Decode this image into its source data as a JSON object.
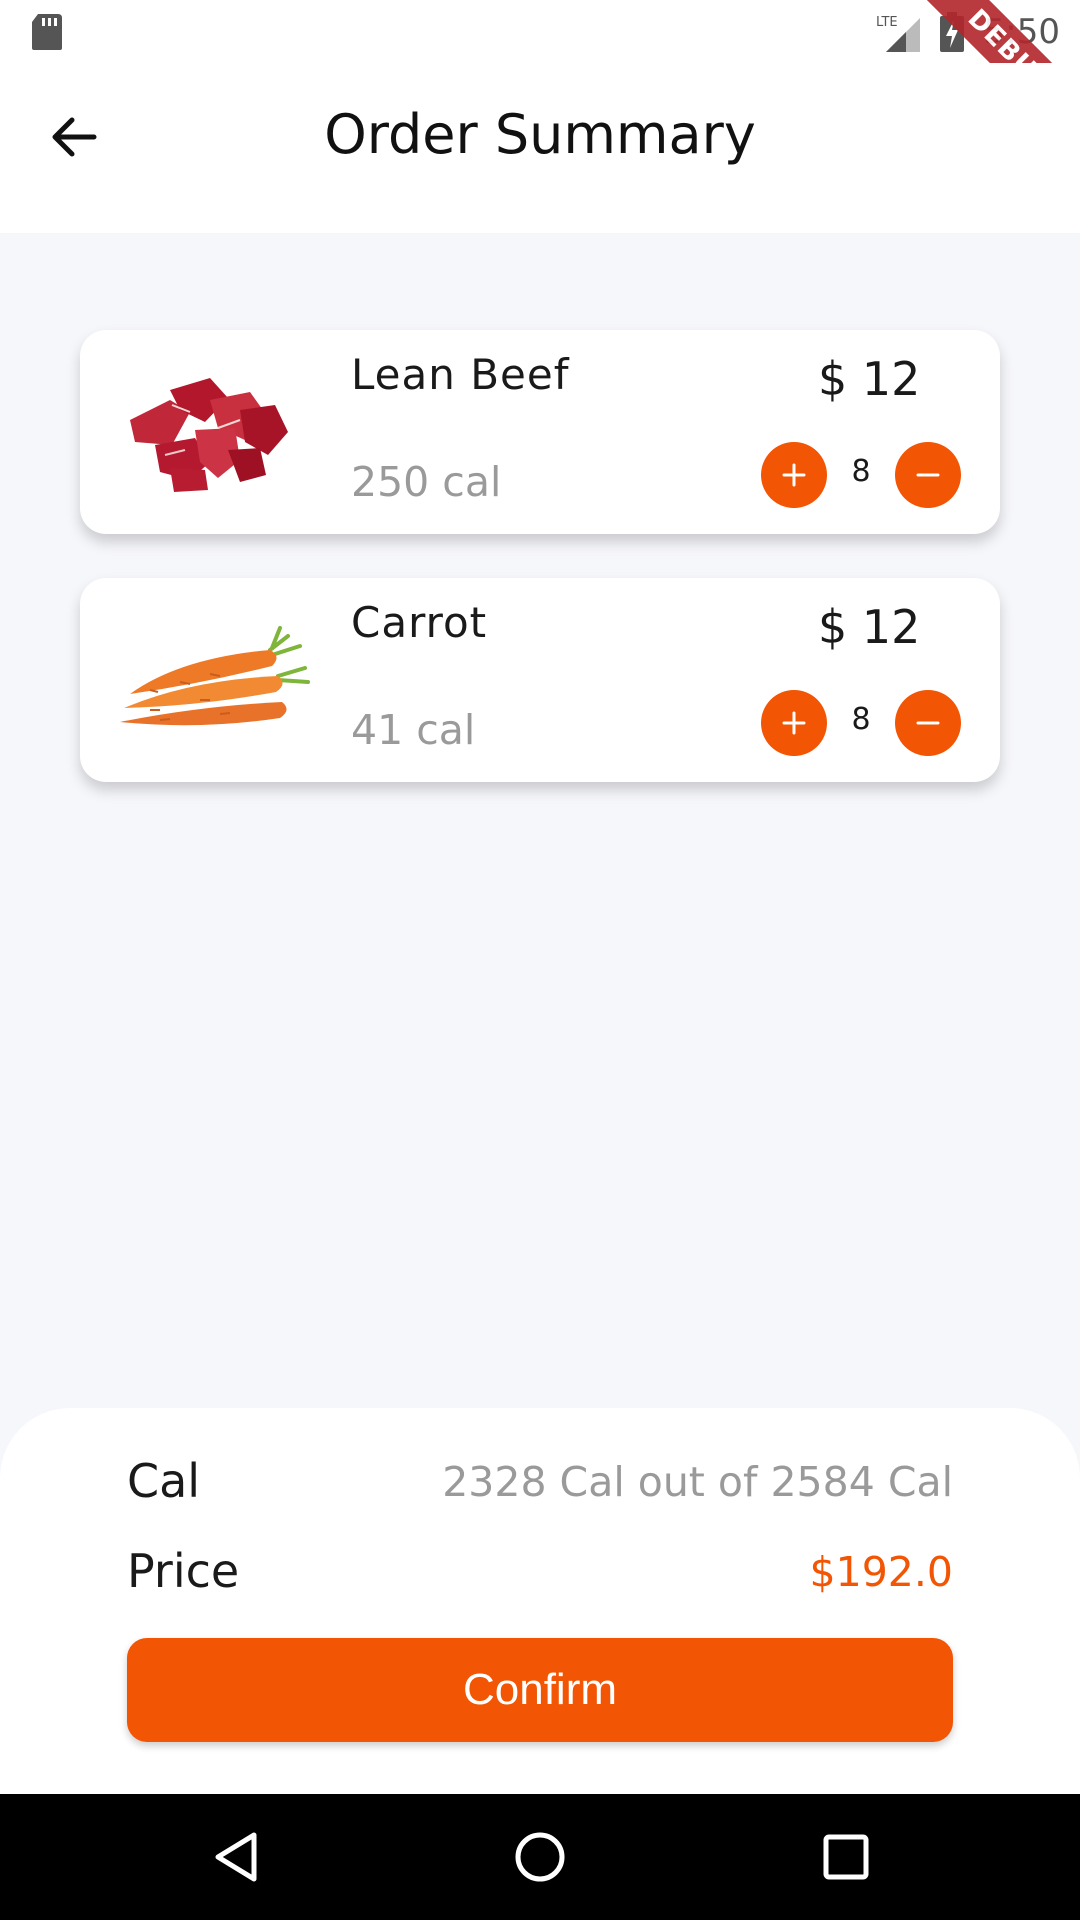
{
  "status_bar": {
    "time": "5:50",
    "network": "LTE",
    "icons": [
      "sd-card-icon",
      "lte-signal-icon",
      "battery-charging-icon"
    ]
  },
  "debug_banner": "DEBUG",
  "app_bar": {
    "title": "Order Summary",
    "back_icon": "arrow-back-icon"
  },
  "items": [
    {
      "name": "Lean Beef",
      "calories": "250 cal",
      "price": "$ 12",
      "quantity": "8",
      "image": "beef-image"
    },
    {
      "name": "Carrot",
      "calories": "41 cal",
      "price": "$ 12",
      "quantity": "8",
      "image": "carrot-image"
    }
  ],
  "summary": {
    "cal_label": "Cal",
    "cal_value": "2328 Cal out of 2584 Cal",
    "price_label": "Price",
    "price_value": "$192.0",
    "confirm_label": "Confirm"
  },
  "colors": {
    "accent": "#f25503",
    "background": "#f6f7fb",
    "card": "#ffffff",
    "muted_text": "#9a9a9a"
  }
}
